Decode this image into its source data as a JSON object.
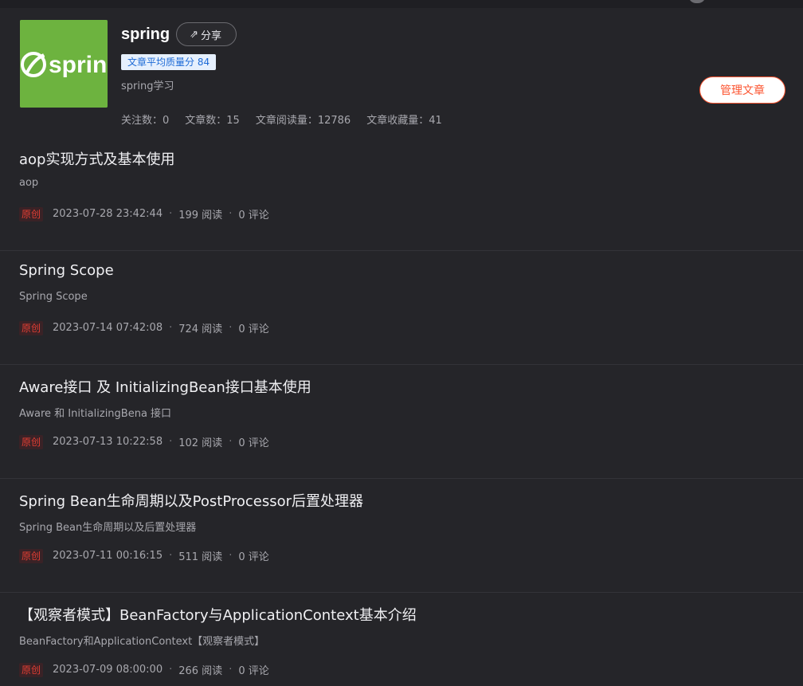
{
  "column": {
    "title": "spring",
    "share_label": "分享",
    "share_icon": "share-arrow-icon",
    "quality_badge": "文章平均质量分 84",
    "description": "spring学习",
    "cover_logo_text": "spring",
    "cover_color": "#6db33f",
    "manage_label": "管理文章",
    "stats": {
      "followers": "关注数：0",
      "articles": "文章数：15",
      "reads": "文章阅读量：12786",
      "favorites": "文章收藏量：41"
    }
  },
  "articles": [
    {
      "title": "aop实现方式及基本使用",
      "summary": "aop",
      "tag": "原创",
      "datetime": "2023-07-28 23:42:44",
      "reads": "199 阅读",
      "comments": "0 评论"
    },
    {
      "title": "Spring Scope",
      "summary": "Spring Scope",
      "tag": "原创",
      "datetime": "2023-07-14 07:42:08",
      "reads": "724 阅读",
      "comments": "0 评论"
    },
    {
      "title": "Aware接口 及 InitializingBean接口基本使用",
      "summary": "Aware 和 InitializingBena 接口",
      "tag": "原创",
      "datetime": "2023-07-13 10:22:58",
      "reads": "102 阅读",
      "comments": "0 评论"
    },
    {
      "title": "Spring Bean生命周期以及PostProcessor后置处理器",
      "summary": "Spring Bean生命周期以及后置处理器",
      "tag": "原创",
      "datetime": "2023-07-11 00:16:15",
      "reads": "511 阅读",
      "comments": "0 评论"
    },
    {
      "title": "【观察者模式】BeanFactory与ApplicationContext基本介绍",
      "summary": "BeanFactory和ApplicationContext【观察者模式】",
      "tag": "原创",
      "datetime": "2023-07-09 08:00:00",
      "reads": "266 阅读",
      "comments": "0 评论"
    }
  ],
  "colors": {
    "background": "#252529",
    "accent_red": "#fc5531",
    "badge_blue": "#1c6ad6"
  }
}
